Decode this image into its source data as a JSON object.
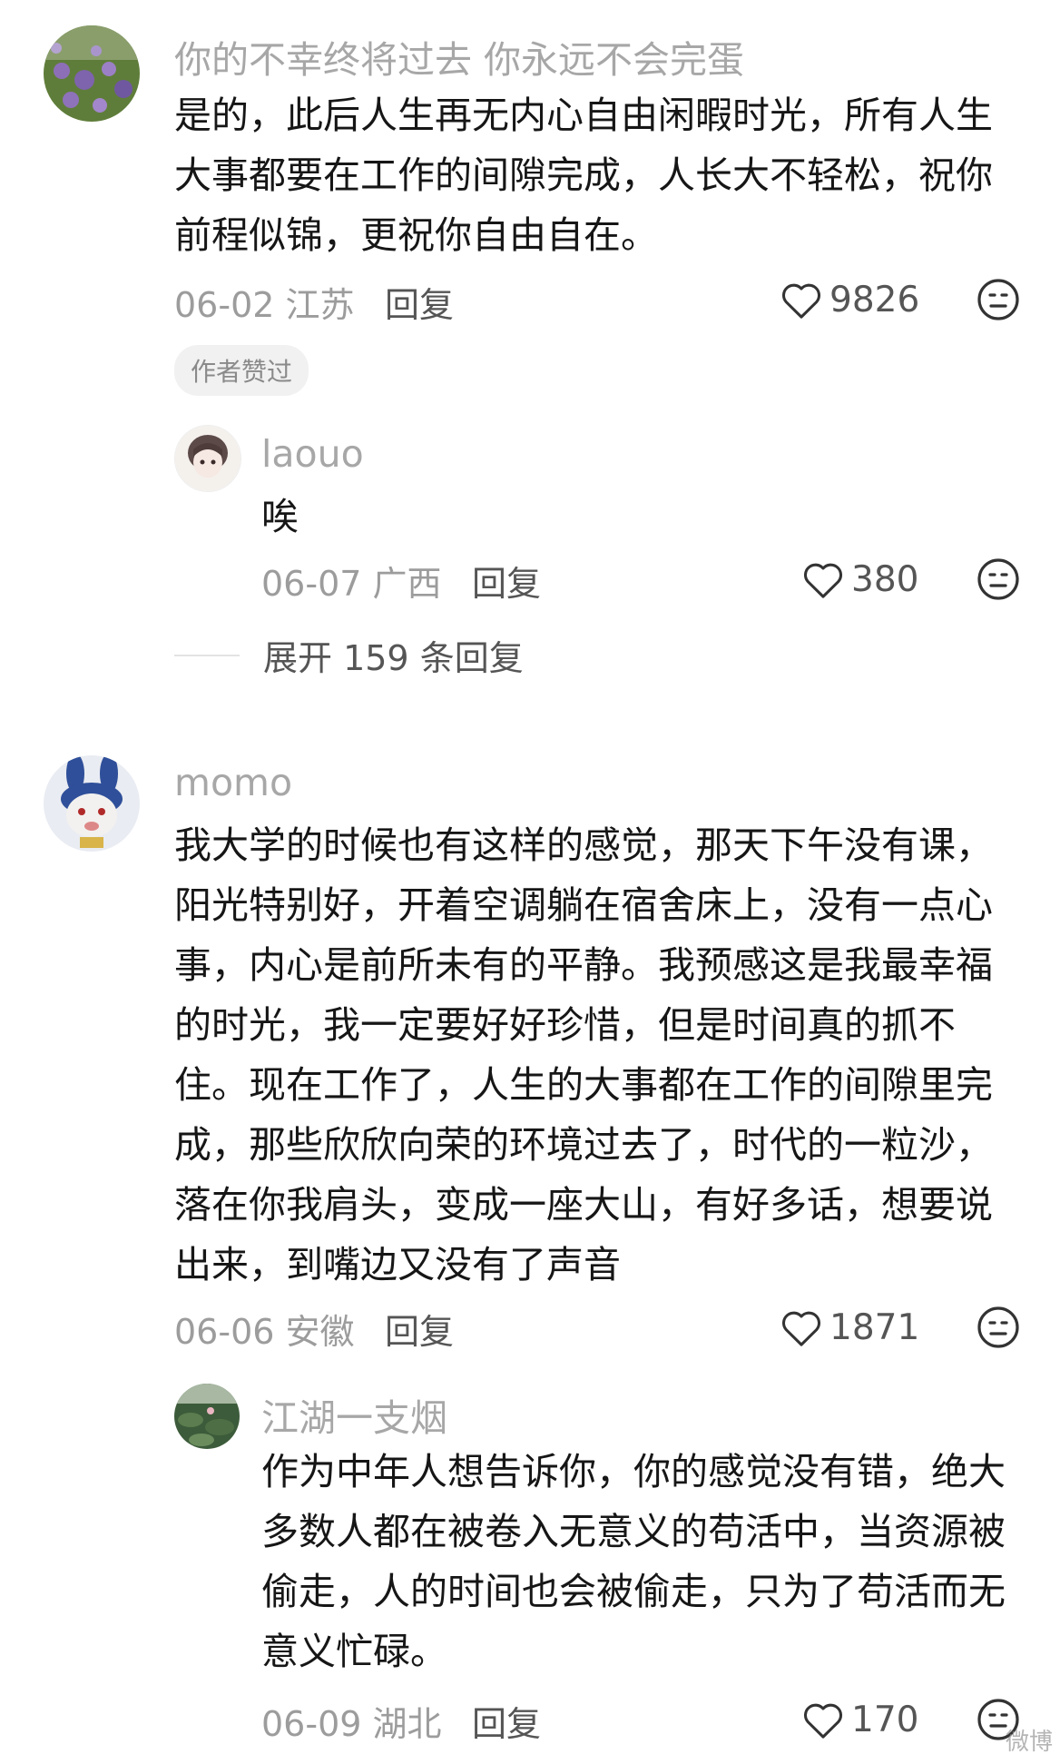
{
  "comments": [
    {
      "username": "你的不幸终将过去 你永远不会完蛋",
      "text": "是的，此后人生再无内心自由闲暇时光，所有人生大事都要在工作的间隙完成，人长大不轻松，祝你前程似锦，更祝你自由自在。",
      "date_location": "06-02 江苏",
      "reply_label": "回复",
      "likes": "9826",
      "badge": "作者赞过",
      "avatar_color": "#5f7d3a",
      "replies": [
        {
          "username": "laouo",
          "text": "唉",
          "date_location": "06-07 广西",
          "reply_label": "回复",
          "likes": "380",
          "avatar_color": "#ece7e3"
        }
      ],
      "expand_label": "展开 159 条回复"
    },
    {
      "username": "momo",
      "text": "我大学的时候也有这样的感觉，那天下午没有课，阳光特别好，开着空调躺在宿舍床上，没有一点心事，内心是前所未有的平静。我预感这是我最幸福的时光，我一定要好好珍惜，但是时间真的抓不住。现在工作了，人生的大事都在工作的间隙里完成，那些欣欣向荣的环境过去了，时代的一粒沙，落在你我肩头，变成一座大山，有好多话，想要说出来，到嘴边又没有了声音",
      "date_location": "06-06 安徽",
      "reply_label": "回复",
      "likes": "1871",
      "avatar_color": "#2f4f9a",
      "replies": [
        {
          "username": "江湖一支烟",
          "text": "作为中年人想告诉你，你的感觉没有错，绝大多数人都在被卷入无意义的苟活中，当资源被偷走，人的时间也会被偷走，只为了苟活而无意义忙碌。",
          "date_location": "06-09 湖北",
          "reply_label": "回复",
          "likes": "170",
          "avatar_color": "#3c5b3a"
        }
      ]
    }
  ],
  "watermark": "微博"
}
